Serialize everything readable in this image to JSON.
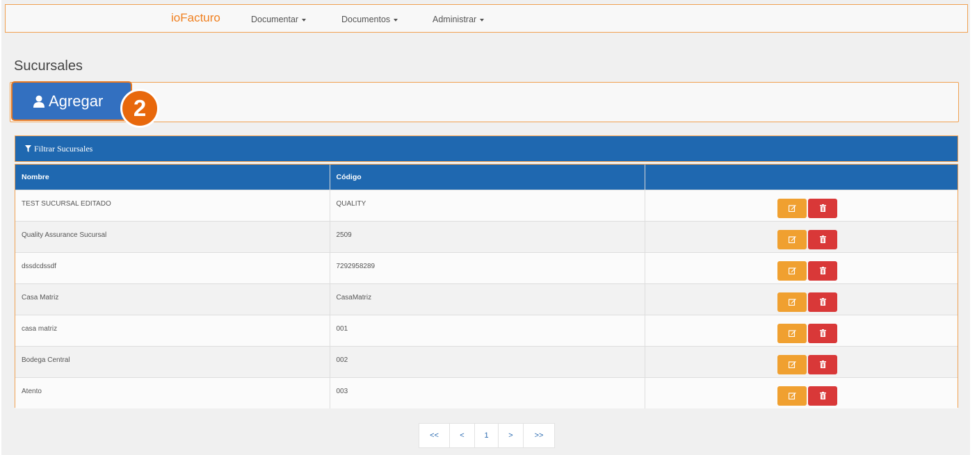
{
  "navbar": {
    "brand": "ioFacturo",
    "menus": [
      {
        "label": "Documentar"
      },
      {
        "label": "Documentos"
      },
      {
        "label": "Administrar"
      }
    ]
  },
  "page": {
    "title": "Sucursales",
    "add_button": "Agregar",
    "step_badge": "2",
    "filter_label": "Filtrar Sucursales"
  },
  "table": {
    "headers": [
      "Nombre",
      "Código",
      ""
    ],
    "rows": [
      {
        "nombre": "TEST SUCURSAL EDITADO",
        "codigo": "QUALITY"
      },
      {
        "nombre": "Quality Assurance Sucursal",
        "codigo": "2509"
      },
      {
        "nombre": "dssdcdssdf",
        "codigo": "7292958289"
      },
      {
        "nombre": "Casa Matriz",
        "codigo": "CasaMatriz"
      },
      {
        "nombre": "casa matriz",
        "codigo": "001"
      },
      {
        "nombre": "Bodega Central",
        "codigo": "002"
      },
      {
        "nombre": "Atento",
        "codigo": "003"
      }
    ]
  },
  "pagination": {
    "first": "<<",
    "prev": "<",
    "current": "1",
    "next": ">",
    "last": ">>"
  },
  "colors": {
    "brand": "#f08020",
    "primary": "#1f68b0",
    "edit": "#f0a030",
    "delete": "#d93838",
    "highlight": "#e8680c"
  }
}
